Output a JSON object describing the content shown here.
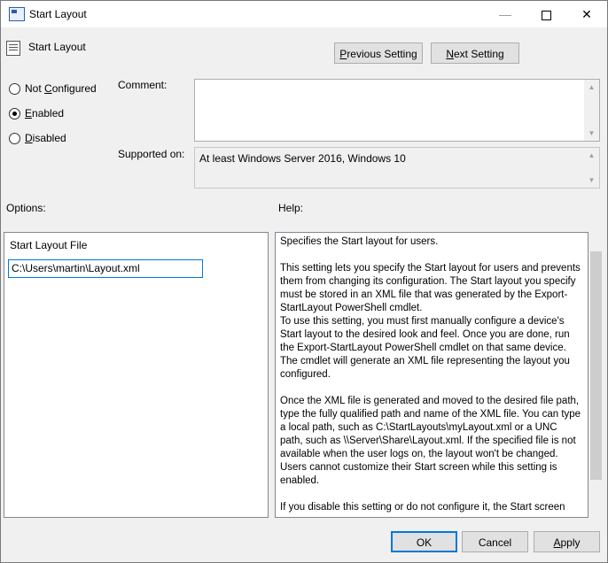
{
  "window": {
    "title": "Start Layout",
    "controls": {
      "minimize": "—",
      "close": "✕"
    }
  },
  "policy_name": "Start Layout",
  "nav": {
    "previous_label_pre": "",
    "previous_label_key": "P",
    "previous_label_post": "revious Setting",
    "next_label_key": "N",
    "next_label_post": "ext Setting"
  },
  "state": {
    "options": [
      {
        "key": "C",
        "pre": "Not ",
        "post": "onfigured",
        "selected": false
      },
      {
        "key": "E",
        "pre": "",
        "post": "nabled",
        "selected": true
      },
      {
        "key": "D",
        "pre": "",
        "post": "isabled",
        "selected": false
      }
    ]
  },
  "comment": {
    "label": "Comment:",
    "value": ""
  },
  "supported": {
    "label": "Supported on:",
    "value": "At least Windows Server 2016, Windows 10"
  },
  "options_section": {
    "label": "Options:",
    "field_label": "Start Layout File",
    "field_value": "C:\\Users\\martin\\Layout.xml"
  },
  "help_section": {
    "label": "Help:",
    "paragraphs": [
      "Specifies the Start layout for users.",
      "This setting lets you specify the Start layout for users and prevents them from changing its configuration. The Start layout you specify must be stored in an XML file that was generated by the Export-StartLayout PowerShell cmdlet.",
      "To use this setting, you must first manually configure a device's Start layout to the desired look and feel. Once you are done, run the Export-StartLayout PowerShell cmdlet on that same device. The cmdlet will generate an XML file representing the layout you configured.",
      "Once the XML file is generated and moved to the desired file path, type the fully qualified path and name of the XML file. You can type a local path, such as C:\\StartLayouts\\myLayout.xml or a UNC path, such as \\\\Server\\Share\\Layout.xml. If the specified file is not available when the user logs on, the layout won't be changed. Users cannot customize their Start screen while this setting is enabled.",
      "If you disable this setting or do not configure it, the Start screen"
    ]
  },
  "footer": {
    "ok_label": "OK",
    "cancel_label": "Cancel",
    "apply_key": "A",
    "apply_post": "pply"
  }
}
